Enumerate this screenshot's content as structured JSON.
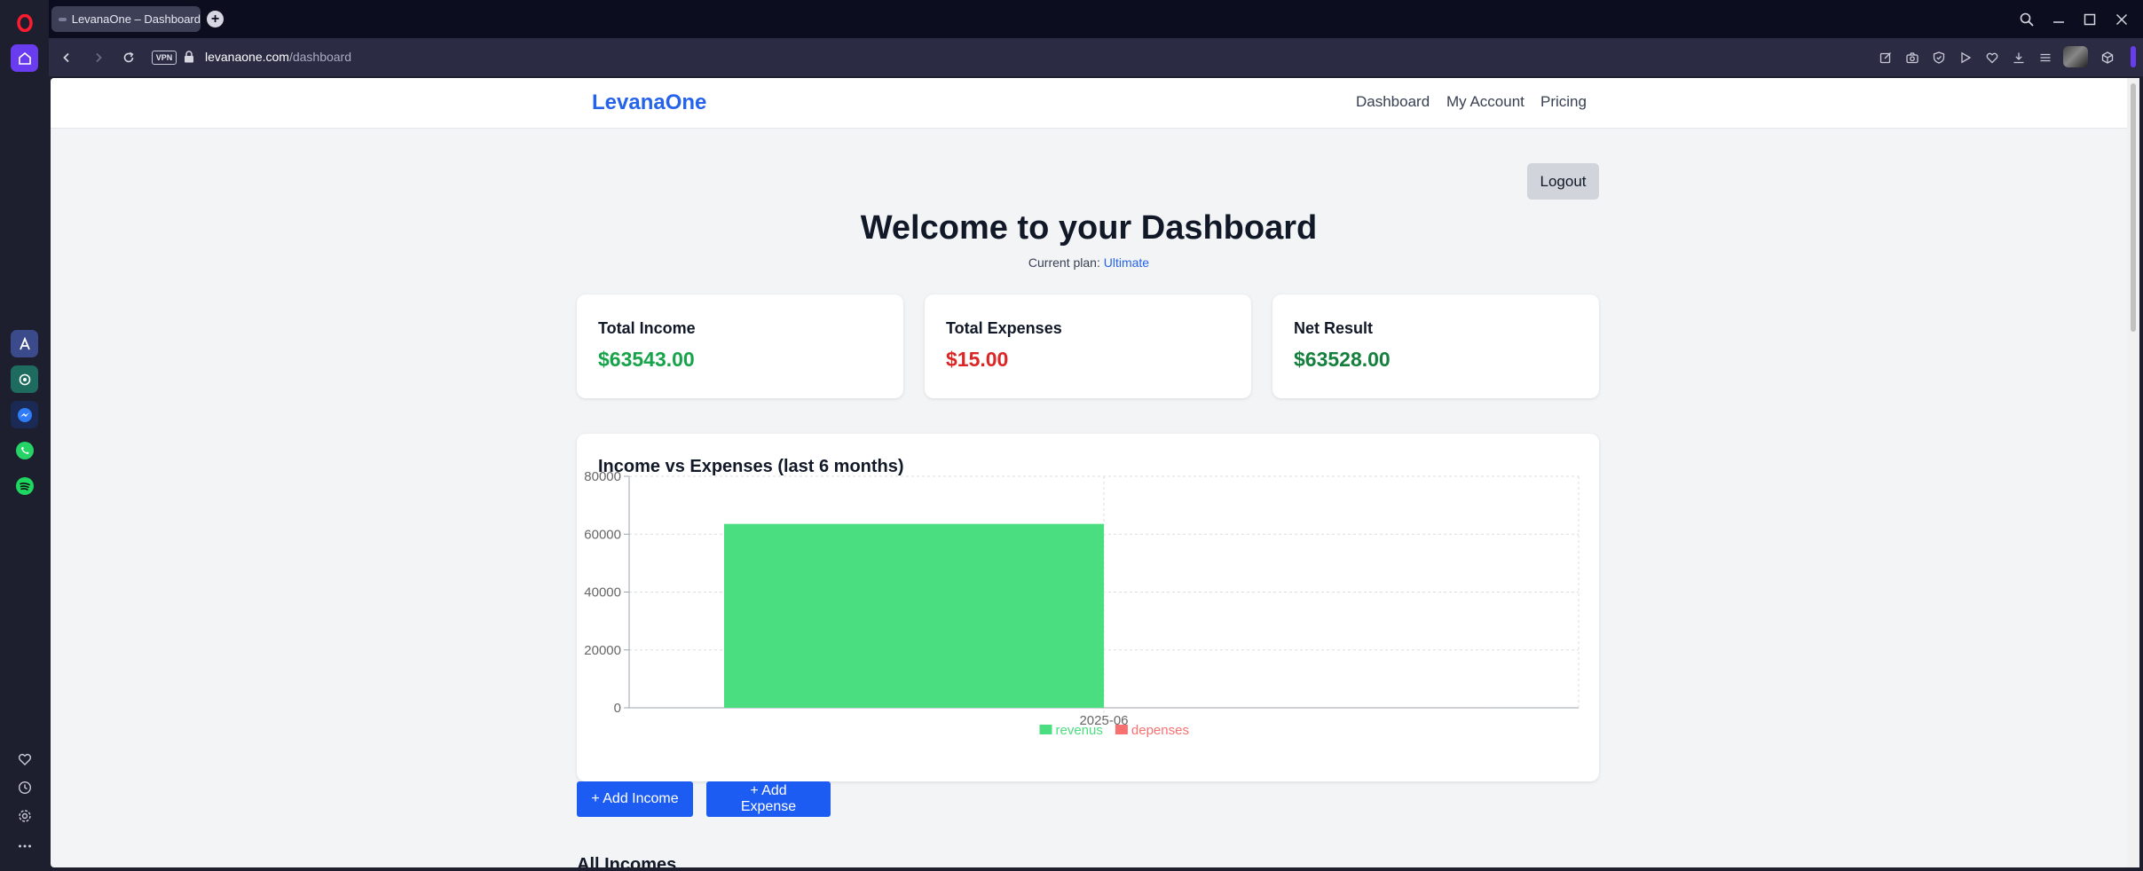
{
  "browser": {
    "tab_title": "LevanaOne – Dashboard",
    "new_tab": "+",
    "vpn_label": "VPN",
    "url_domain": "levanaone.com",
    "url_path": "/dashboard",
    "sidebar_icons": [
      "opera-logo-icon",
      "home-icon",
      "aria-icon",
      "chatgpt-icon",
      "messenger-icon",
      "whatsapp-icon",
      "spotify-icon",
      "heart-icon",
      "history-icon",
      "settings-icon",
      "more-icon"
    ],
    "toolbar_icons": [
      "snap-icon",
      "camera-icon",
      "shield-icon",
      "play-icon",
      "heart-icon",
      "download-icon",
      "menu-icon",
      "profile-icon",
      "extensions-icon"
    ]
  },
  "site": {
    "brand": "LevanaOne",
    "nav": {
      "dashboard": "Dashboard",
      "account": "My Account",
      "pricing": "Pricing"
    },
    "logout": "Logout"
  },
  "dashboard": {
    "title": "Welcome to your Dashboard",
    "plan_prefix": "Current plan:",
    "plan_name": "Ultimate",
    "cards": {
      "income": {
        "label": "Total Income",
        "value": "$63543.00",
        "color": "#16a34a"
      },
      "expenses": {
        "label": "Total Expenses",
        "value": "$15.00",
        "color": "#dc2626"
      },
      "net": {
        "label": "Net Result",
        "value": "$63528.00",
        "color": "#15803d"
      }
    },
    "buttons": {
      "add_income": "+ Add Income",
      "add_expense": "+ Add Expense"
    },
    "section_incomes": "All Incomes"
  },
  "chart_data": {
    "type": "bar",
    "title": "Income vs Expenses (last 6 months)",
    "categories": [
      "2025-06"
    ],
    "series": [
      {
        "name": "revenus",
        "values": [
          63543
        ],
        "color": "#4ade80"
      },
      {
        "name": "depenses",
        "values": [
          15
        ],
        "color": "#f87171"
      }
    ],
    "ylim": [
      0,
      80000
    ],
    "yticks": [
      0,
      20000,
      40000,
      60000,
      80000
    ],
    "grid": true,
    "legend": "bottom"
  }
}
